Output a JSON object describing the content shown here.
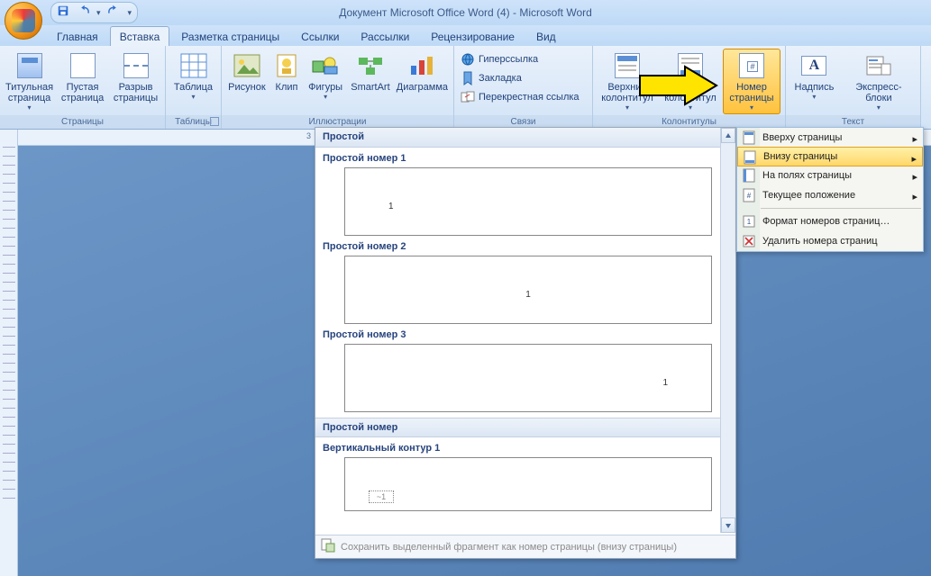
{
  "title": "Документ Microsoft Office Word (4) - Microsoft Word",
  "tabs": {
    "home": "Главная",
    "insert": "Вставка",
    "layout": "Разметка страницы",
    "refs": "Ссылки",
    "mail": "Рассылки",
    "review": "Рецензирование",
    "view": "Вид"
  },
  "ribbon": {
    "pages": {
      "title_page": "Титульная\nстраница",
      "blank_page": "Пустая\nстраница",
      "page_break": "Разрыв\nстраницы",
      "group": "Страницы"
    },
    "tables": {
      "table": "Таблица",
      "group": "Таблицы"
    },
    "illus": {
      "picture": "Рисунок",
      "clip": "Клип",
      "shapes": "Фигуры",
      "smartart": "SmartArt",
      "chart": "Диаграмма",
      "group": "Иллюстрации"
    },
    "links": {
      "hyperlink": "Гиперссылка",
      "bookmark": "Закладка",
      "crossref": "Перекрестная ссылка",
      "group": "Связи"
    },
    "hf": {
      "header": "Верхний\nколонтитул",
      "footer": "Нижний\nколонтитул",
      "page_no": "Номер\nстраницы",
      "group": "Колонтитулы"
    },
    "text": {
      "textbox": "Надпись",
      "quickparts": "Экспресс-блоки",
      "group": "Текст"
    }
  },
  "pn_menu": {
    "top": "Вверху страницы",
    "bottom": "Внизу страницы",
    "margins": "На полях страницы",
    "current": "Текущее положение",
    "format": "Формат номеров страниц…",
    "remove": "Удалить номера страниц"
  },
  "gallery": {
    "head1": "Простой",
    "items": [
      {
        "label": "Простой номер 1",
        "pos": "left"
      },
      {
        "label": "Простой номер 2",
        "pos": "center"
      },
      {
        "label": "Простой номер 3",
        "pos": "right"
      }
    ],
    "head2": "Простой номер",
    "item2_label": "Вертикальный контур 1",
    "footer": "Сохранить выделенный фрагмент как номер страницы (внизу страницы)"
  },
  "ruler_mark": "3"
}
